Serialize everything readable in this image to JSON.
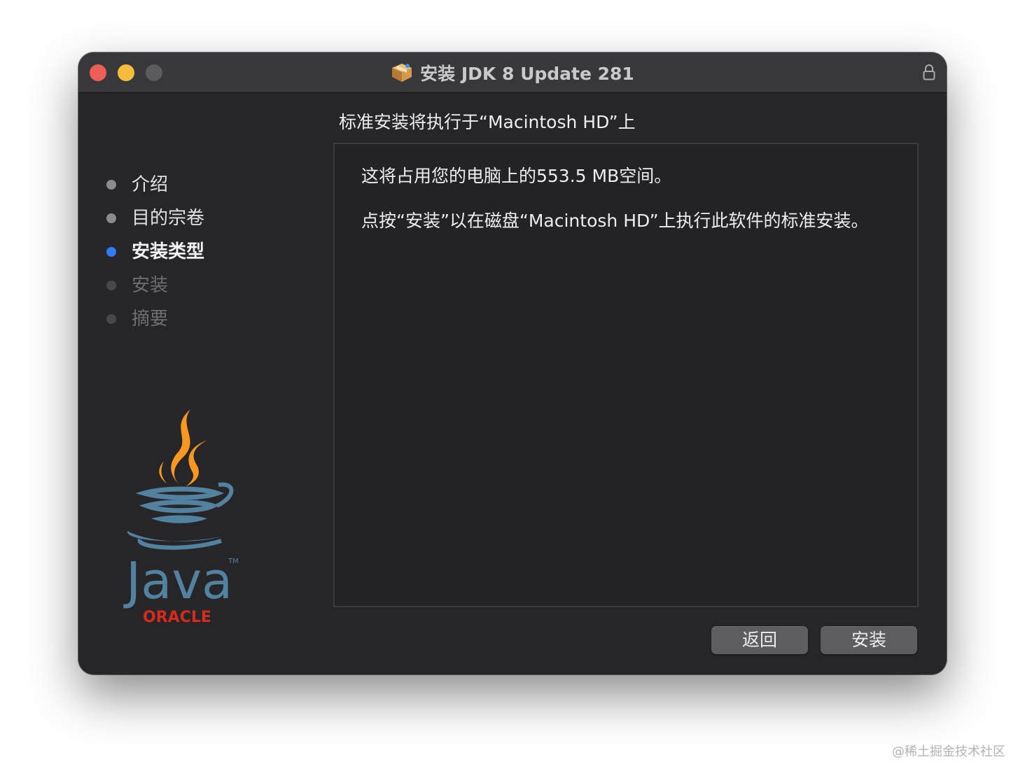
{
  "window": {
    "title": "安装 JDK 8 Update 281",
    "title_icon": "package-icon",
    "lock_icon": "lock-icon"
  },
  "sidebar": {
    "steps": [
      {
        "label": "介绍",
        "state": "done"
      },
      {
        "label": "目的宗卷",
        "state": "done"
      },
      {
        "label": "安装类型",
        "state": "current"
      },
      {
        "label": "安装",
        "state": "future"
      },
      {
        "label": "摘要",
        "state": "future"
      }
    ],
    "logo": {
      "brand": "Java",
      "vendor": "ORACLE",
      "trademark": "TM"
    }
  },
  "main": {
    "heading": "标准安装将执行于“Macintosh HD”上",
    "paragraph1": "这将占用您的电脑上的553.5 MB空间。",
    "paragraph2": "点按“安装”以在磁盘“Macintosh HD”上执行此软件的标准安装。"
  },
  "buttons": {
    "back": "返回",
    "install": "安装"
  },
  "watermark": "@稀土掘金技术社区",
  "colors": {
    "accent": "#2f7cf6",
    "close": "#ec5f57",
    "minimize": "#f4bd3b",
    "oracle_red": "#d52b1e",
    "java_blue": "#5382a1",
    "java_orange": "#f89820"
  }
}
